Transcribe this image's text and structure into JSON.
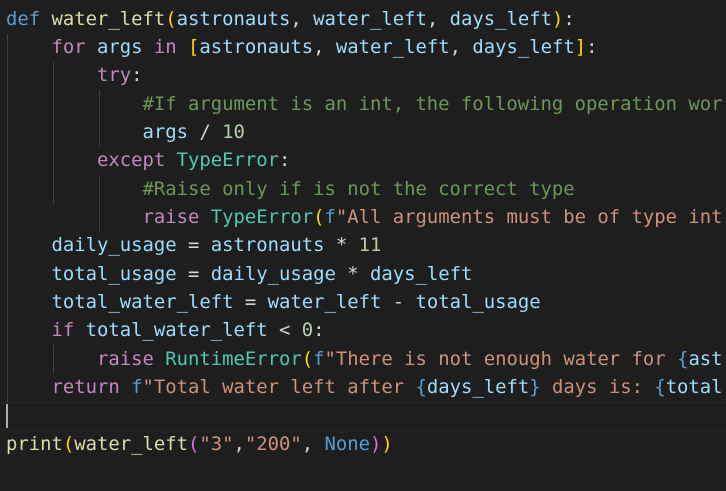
{
  "editor": {
    "lines": [
      [
        {
          "t": "def",
          "c": "kw"
        },
        {
          "t": " ",
          "c": "op"
        },
        {
          "t": "water_left",
          "c": "fn"
        },
        {
          "t": "(",
          "c": "br1"
        },
        {
          "t": "astronauts",
          "c": "var"
        },
        {
          "t": ", ",
          "c": "op"
        },
        {
          "t": "water_left",
          "c": "var"
        },
        {
          "t": ", ",
          "c": "op"
        },
        {
          "t": "days_left",
          "c": "var"
        },
        {
          "t": ")",
          "c": "br1"
        },
        {
          "t": ":",
          "c": "op"
        }
      ],
      [
        {
          "t": "    ",
          "c": "op"
        },
        {
          "t": "for",
          "c": "ctl"
        },
        {
          "t": " ",
          "c": "op"
        },
        {
          "t": "args",
          "c": "var"
        },
        {
          "t": " ",
          "c": "op"
        },
        {
          "t": "in",
          "c": "ctl"
        },
        {
          "t": " ",
          "c": "op"
        },
        {
          "t": "[",
          "c": "br1"
        },
        {
          "t": "astronauts",
          "c": "var"
        },
        {
          "t": ", ",
          "c": "op"
        },
        {
          "t": "water_left",
          "c": "var"
        },
        {
          "t": ", ",
          "c": "op"
        },
        {
          "t": "days_left",
          "c": "var"
        },
        {
          "t": "]",
          "c": "br1"
        },
        {
          "t": ":",
          "c": "op"
        }
      ],
      [
        {
          "t": "        ",
          "c": "op"
        },
        {
          "t": "try",
          "c": "ctl"
        },
        {
          "t": ":",
          "c": "op"
        }
      ],
      [
        {
          "t": "            ",
          "c": "op"
        },
        {
          "t": "#If argument is an int, the following operation wor",
          "c": "cmt"
        }
      ],
      [
        {
          "t": "            ",
          "c": "op"
        },
        {
          "t": "args",
          "c": "var"
        },
        {
          "t": " / ",
          "c": "op"
        },
        {
          "t": "10",
          "c": "num"
        }
      ],
      [
        {
          "t": "        ",
          "c": "op"
        },
        {
          "t": "except",
          "c": "ctl"
        },
        {
          "t": " ",
          "c": "op"
        },
        {
          "t": "TypeError",
          "c": "cls"
        },
        {
          "t": ":",
          "c": "op"
        }
      ],
      [
        {
          "t": "            ",
          "c": "op"
        },
        {
          "t": "#Raise only if is not the correct type",
          "c": "cmt"
        }
      ],
      [
        {
          "t": "            ",
          "c": "op"
        },
        {
          "t": "raise",
          "c": "ctl"
        },
        {
          "t": " ",
          "c": "op"
        },
        {
          "t": "TypeError",
          "c": "cls"
        },
        {
          "t": "(",
          "c": "br1"
        },
        {
          "t": "f",
          "c": "kw"
        },
        {
          "t": "\"All arguments must be of type int",
          "c": "str"
        }
      ],
      [
        {
          "t": "    ",
          "c": "op"
        },
        {
          "t": "daily_usage",
          "c": "var"
        },
        {
          "t": " = ",
          "c": "op"
        },
        {
          "t": "astronauts",
          "c": "var"
        },
        {
          "t": " * ",
          "c": "op"
        },
        {
          "t": "11",
          "c": "num"
        }
      ],
      [
        {
          "t": "    ",
          "c": "op"
        },
        {
          "t": "total_usage",
          "c": "var"
        },
        {
          "t": " = ",
          "c": "op"
        },
        {
          "t": "daily_usage",
          "c": "var"
        },
        {
          "t": " * ",
          "c": "op"
        },
        {
          "t": "days_left",
          "c": "var"
        }
      ],
      [
        {
          "t": "    ",
          "c": "op"
        },
        {
          "t": "total_water_left",
          "c": "var"
        },
        {
          "t": " = ",
          "c": "op"
        },
        {
          "t": "water_left",
          "c": "var"
        },
        {
          "t": " - ",
          "c": "op"
        },
        {
          "t": "total_usage",
          "c": "var"
        }
      ],
      [
        {
          "t": "    ",
          "c": "op"
        },
        {
          "t": "if",
          "c": "ctl"
        },
        {
          "t": " ",
          "c": "op"
        },
        {
          "t": "total_water_left",
          "c": "var"
        },
        {
          "t": " < ",
          "c": "op"
        },
        {
          "t": "0",
          "c": "num"
        },
        {
          "t": ":",
          "c": "op"
        }
      ],
      [
        {
          "t": "        ",
          "c": "op"
        },
        {
          "t": "raise",
          "c": "ctl"
        },
        {
          "t": " ",
          "c": "op"
        },
        {
          "t": "RuntimeError",
          "c": "cls"
        },
        {
          "t": "(",
          "c": "br1"
        },
        {
          "t": "f",
          "c": "kw"
        },
        {
          "t": "\"There is not enough water for ",
          "c": "str"
        },
        {
          "t": "{",
          "c": "kw"
        },
        {
          "t": "ast",
          "c": "var"
        }
      ],
      [
        {
          "t": "    ",
          "c": "op"
        },
        {
          "t": "return",
          "c": "ctl"
        },
        {
          "t": " ",
          "c": "op"
        },
        {
          "t": "f",
          "c": "kw"
        },
        {
          "t": "\"Total water left after ",
          "c": "str"
        },
        {
          "t": "{",
          "c": "kw"
        },
        {
          "t": "days_left",
          "c": "var"
        },
        {
          "t": "}",
          "c": "kw"
        },
        {
          "t": " days is: ",
          "c": "str"
        },
        {
          "t": "{",
          "c": "kw"
        },
        {
          "t": "total",
          "c": "var"
        }
      ],
      [],
      [
        {
          "t": "print",
          "c": "fn"
        },
        {
          "t": "(",
          "c": "br1"
        },
        {
          "t": "water_left",
          "c": "fn"
        },
        {
          "t": "(",
          "c": "br2"
        },
        {
          "t": "\"3\"",
          "c": "str"
        },
        {
          "t": ",",
          "c": "op"
        },
        {
          "t": "\"200\"",
          "c": "str"
        },
        {
          "t": ", ",
          "c": "op"
        },
        {
          "t": "None",
          "c": "kw"
        },
        {
          "t": ")",
          "c": "br2"
        },
        {
          "t": ")",
          "c": "br1"
        }
      ]
    ]
  }
}
